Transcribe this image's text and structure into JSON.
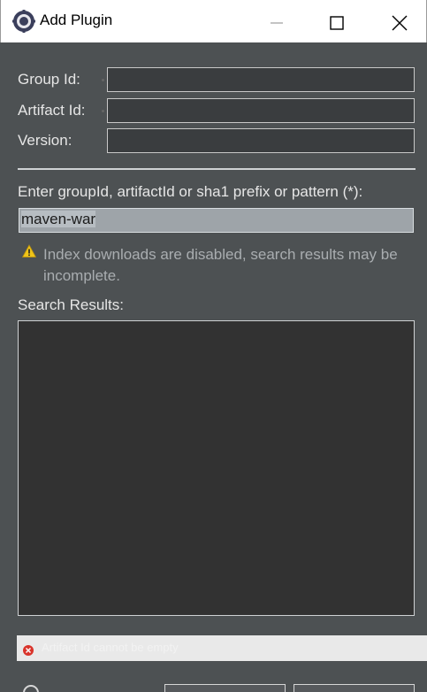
{
  "window": {
    "title": "Add Plugin",
    "icon": "eclipse-icon"
  },
  "form": {
    "group_id_label": "Group Id:",
    "group_id_value": "",
    "artifact_id_label": "Artifact Id:",
    "artifact_id_value": "",
    "version_label": "Version:",
    "version_value": ""
  },
  "search": {
    "prompt": "Enter groupId, artifactId or sha1 prefix or pattern (*):",
    "value": "maven-war"
  },
  "warning": {
    "icon": "warning-icon",
    "text": "Index downloads are disabled, search results may be incomplete."
  },
  "results": {
    "label": "Search Results:",
    "items": []
  },
  "status": {
    "icon": "error-icon",
    "text": "Artifact Id cannot be empty"
  },
  "colors": {
    "background": "#4d5153",
    "input_bg": "#3a3d3f",
    "results_bg": "#323232",
    "search_bg": "#9ea4a9",
    "warning": "#f0c419",
    "error": "#d9342b"
  }
}
